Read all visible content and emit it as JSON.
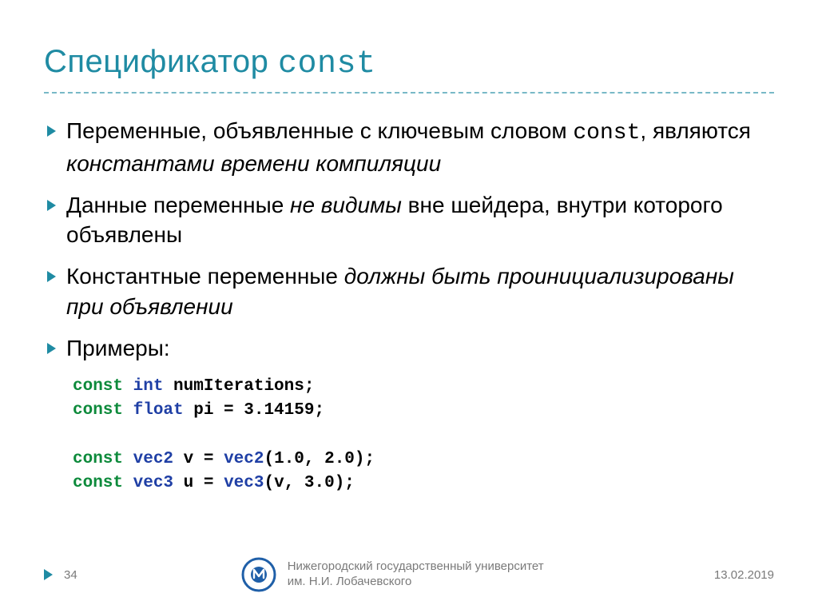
{
  "title_prefix": "Спецификатор ",
  "title_code": "const",
  "bullets": {
    "b1_pre": "Переменные, объявленные с ключевым словом ",
    "b1_code": "const",
    "b1_mid": ", являются ",
    "b1_em": "константами времени компиляции",
    "b2_pre": "Данные переменные ",
    "b2_em": "не видимы",
    "b2_post": " вне шейдера, внутри которого объявлены",
    "b3_pre": "Константные переменные ",
    "b3_em": "должны быть проинициализированы при объявлении",
    "b4": "Примеры:"
  },
  "code": {
    "kw_const": "const",
    "l1_type": "int",
    "l1_rest": " numIterations;",
    "l2_type": "float",
    "l2_rest": " pi = 3.14159;",
    "l3_type": "vec2",
    "l3_mid": " v = ",
    "l3_fn": "vec2",
    "l3_args": "(1.0, 2.0);",
    "l4_type": "vec3",
    "l4_mid": " u = ",
    "l4_fn": "vec3",
    "l4_args": "(v, 3.0);"
  },
  "footer": {
    "page": "34",
    "uni_line1": "Нижегородский государственный университет",
    "uni_line2": "им. Н.И. Лобачевского",
    "date": "13.02.2019"
  }
}
